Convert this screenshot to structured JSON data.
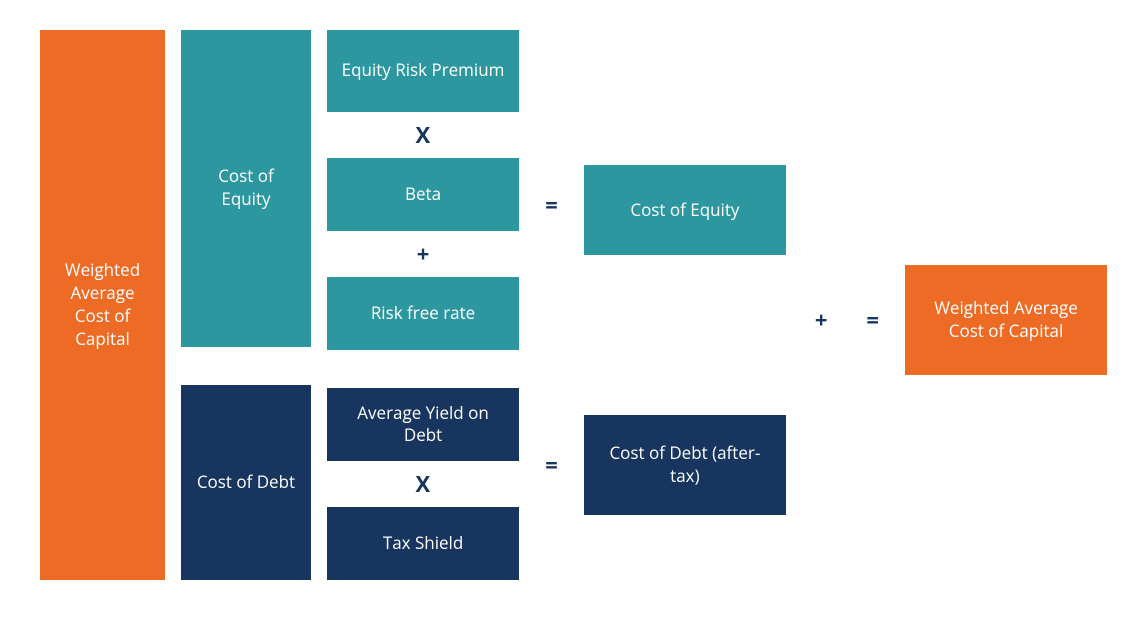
{
  "wacc_left": "Weighted Average Cost of Capital",
  "cost_of_equity_label": "Cost of Equity",
  "cost_of_debt_label": "Cost of Debt",
  "equity_components": {
    "erp": "Equity Risk Premium",
    "beta": "Beta",
    "rfr": "Risk free rate"
  },
  "debt_components": {
    "ayd": "Average Yield on Debt",
    "tax_shield": "Tax Shield"
  },
  "operators": {
    "times": "X",
    "plus": "+",
    "equals": "="
  },
  "results": {
    "cost_of_equity": "Cost of Equity",
    "cost_of_debt_after_tax": "Cost of Debt (after-tax)"
  },
  "wacc_right": "Weighted Average Cost of Capital",
  "colors": {
    "orange": "#ee6b26",
    "teal": "#2d97a0",
    "navy": "#17355e"
  }
}
